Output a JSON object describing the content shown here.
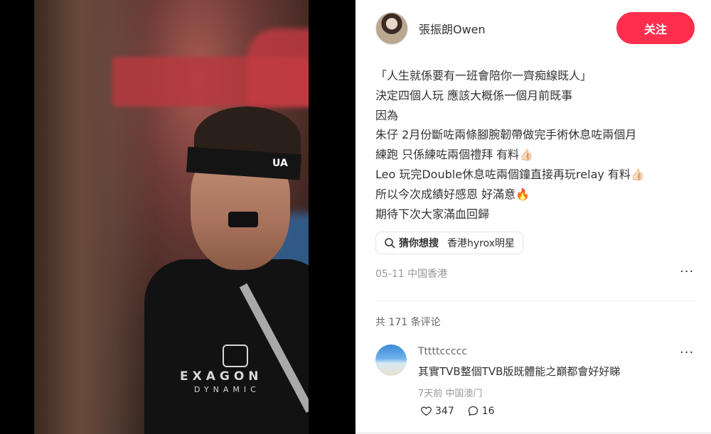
{
  "media": {
    "headband_logo": "UA",
    "shirt_brand_line1": "EXAGON",
    "shirt_brand_line2": "DYNAMIC"
  },
  "author": {
    "name": "張振朗Owen",
    "follow_label": "关注"
  },
  "post": {
    "lines": [
      "「人生就係要有一班會陪你一齊痴線既人」",
      "決定四個人玩 應該大概係一個月前既事",
      "因為",
      "朱仔 2月份斷咗兩條腳腕韌帶做完手術休息咗兩個月",
      "練跑 只係練咗兩個禮拜 有料👍🏻",
      "Leo 玩完Double休息咗兩個鐘直接再玩relay 有料👍🏻",
      "所以今次成績好感恩 好滿意🔥",
      "期待下次大家滿血回歸"
    ],
    "search_chip": {
      "label": "猜你想搜",
      "query": "香港hyrox明星",
      "icon": "search-icon"
    },
    "date_location": "05-11 中国香港",
    "more": "···"
  },
  "comments_header": {
    "count_text": "共 171 条评论"
  },
  "comments": [
    {
      "user": "Tttttccccc",
      "text": "其實TVB整個TVB版既體能之巔都會好好睇",
      "meta": "7天前 中国澳门",
      "likes": "347",
      "replies": "16",
      "more": "···"
    }
  ],
  "colors": {
    "accent": "#ff2e4d",
    "text": "#333333",
    "muted": "#999999"
  }
}
